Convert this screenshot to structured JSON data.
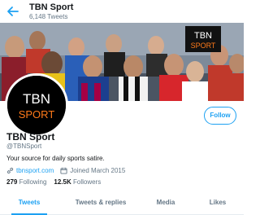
{
  "header": {
    "title": "TBN Sport",
    "tweet_count": "6,148 Tweets"
  },
  "banner": {
    "logo_line1": "TBN",
    "logo_line2": "SPORT"
  },
  "profile": {
    "avatar_line1": "TBN",
    "avatar_line2": "SPORT",
    "display_name": "TBN Sport",
    "handle": "@TBNSport",
    "bio": "Your source for daily sports satire.",
    "website": "tbnsport.com",
    "joined": "Joined March 2015",
    "following_count": "279",
    "following_label": "Following",
    "followers_count": "12.5K",
    "followers_label": "Followers",
    "follow_button": "Follow"
  },
  "tabs": [
    {
      "label": "Tweets",
      "active": true
    },
    {
      "label": "Tweets & replies",
      "active": false
    },
    {
      "label": "Media",
      "active": false
    },
    {
      "label": "Likes",
      "active": false
    }
  ],
  "colors": {
    "accent": "#1da1f2",
    "secondary_text": "#657786",
    "primary_text": "#14171a"
  },
  "icons": [
    "back-arrow-icon",
    "link-icon",
    "calendar-icon"
  ]
}
